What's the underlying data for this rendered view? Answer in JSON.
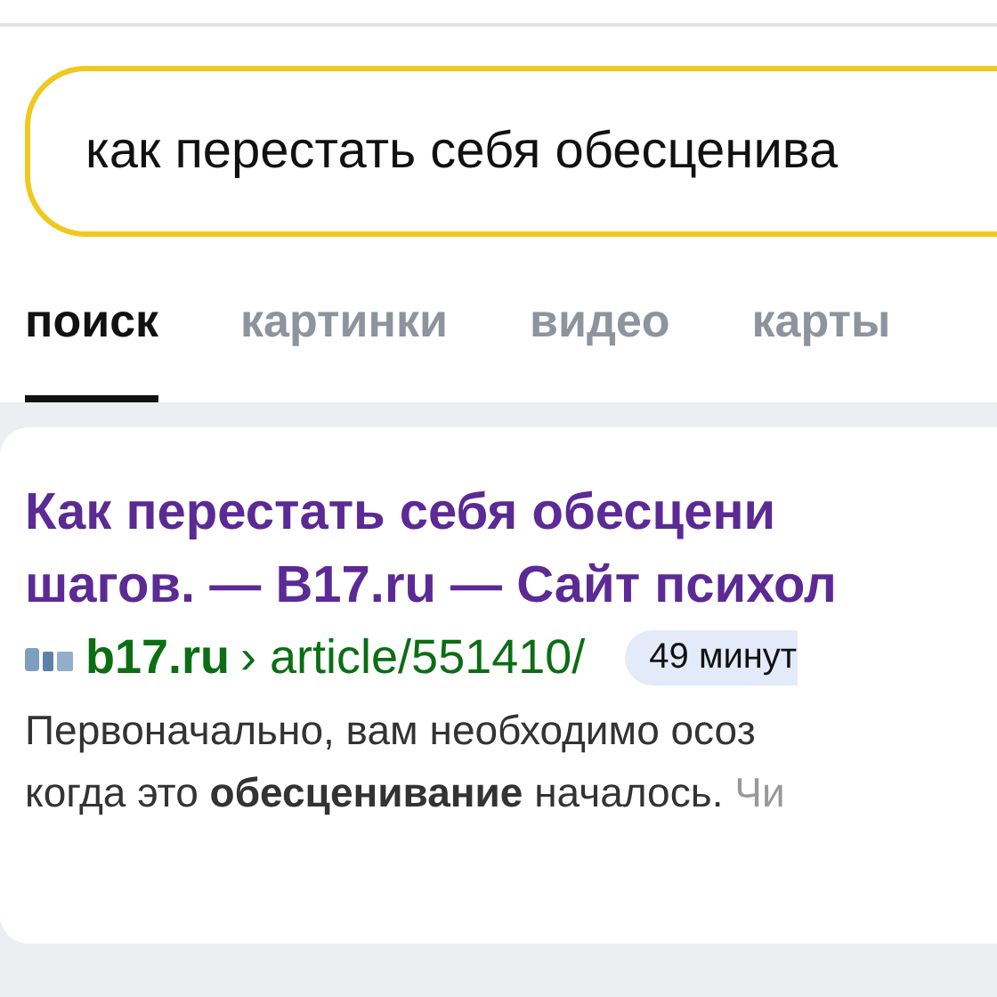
{
  "search": {
    "value": "как перестать себя обесценива"
  },
  "tabs": [
    {
      "label": "поиск",
      "selected": true
    },
    {
      "label": "картинки",
      "selected": false
    },
    {
      "label": "видео",
      "selected": false
    },
    {
      "label": "карты",
      "selected": false
    }
  ],
  "result": {
    "title_lines": [
      "Как перестать себя обесцени",
      "шагов. — B17.ru — Сайт психол"
    ],
    "domain": "b17.ru",
    "separator": "›",
    "path": "article/551410/",
    "time": "49 минут",
    "snippet_lines": [
      "Первоначально, вам необходимо осоз",
      "когда это **обесценивание** началось."
    ],
    "more": "Чи"
  }
}
